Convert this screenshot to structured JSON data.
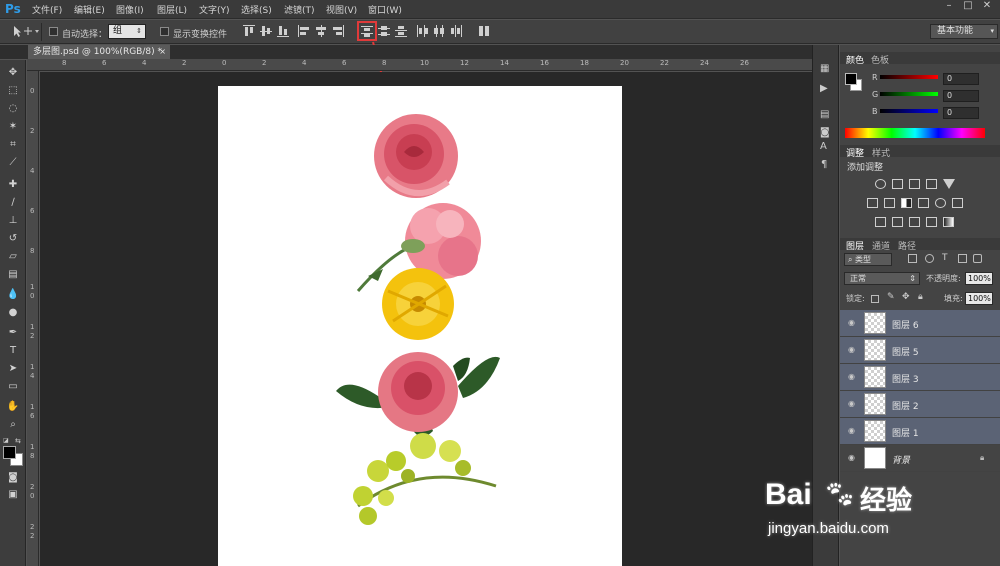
{
  "app": {
    "logo": "Ps"
  },
  "menu": [
    "文件(F)",
    "编辑(E)",
    "图像(I)",
    "图层(L)",
    "文字(Y)",
    "选择(S)",
    "滤镜(T)",
    "视图(V)",
    "窗口(W)"
  ],
  "options": {
    "auto_select_label": "自动选择：",
    "auto_select_value": "组",
    "show_transform_label": "显示变换控件",
    "workspace": "基本功能"
  },
  "document": {
    "tab_title": "多层图.psd @ 100%(RGB/8) *"
  },
  "rulers": {
    "top": [
      "8",
      "6",
      "4",
      "2",
      "0",
      "2",
      "4",
      "6",
      "8",
      "10",
      "12",
      "14",
      "16",
      "18",
      "20",
      "22",
      "24",
      "26"
    ],
    "left": [
      "0",
      "2",
      "4",
      "6",
      "8",
      "1",
      "0",
      "1",
      "2",
      "1",
      "4",
      "1",
      "6",
      "1",
      "8",
      "2",
      "0",
      "2",
      "2"
    ]
  },
  "color_panel": {
    "tabs": [
      "颜色",
      "色板"
    ],
    "channels": [
      {
        "label": "R",
        "value": "0",
        "gradient_end": "#ff0000"
      },
      {
        "label": "G",
        "value": "0",
        "gradient_end": "#00ff00"
      },
      {
        "label": "B",
        "value": "0",
        "gradient_end": "#0000ff"
      }
    ]
  },
  "adjustments_panel": {
    "tabs": [
      "调整",
      "样式"
    ],
    "heading": "添加调整"
  },
  "layers_panel": {
    "tabs": [
      "图层",
      "通道",
      "路径"
    ],
    "filter_kind": "类型",
    "blend_mode": "正常",
    "opacity_label": "不透明度:",
    "opacity_value": "100%",
    "lock_label": "锁定:",
    "fill_label": "填充:",
    "fill_value": "100%",
    "layers": [
      {
        "name": "图层 6",
        "selected": true
      },
      {
        "name": "图层 5",
        "selected": true
      },
      {
        "name": "图层 3",
        "selected": true
      },
      {
        "name": "图层 2",
        "selected": true
      },
      {
        "name": "图层 1",
        "selected": true
      },
      {
        "name": "背景",
        "selected": false,
        "locked": true
      }
    ]
  },
  "watermark": {
    "brand": "Bai",
    "brand2": "经验",
    "url": "jingyan.baidu.com"
  },
  "colors": {
    "accent": "#e03a3a",
    "selection": "#5b6375",
    "ps_blue": "#2f9ce8"
  }
}
